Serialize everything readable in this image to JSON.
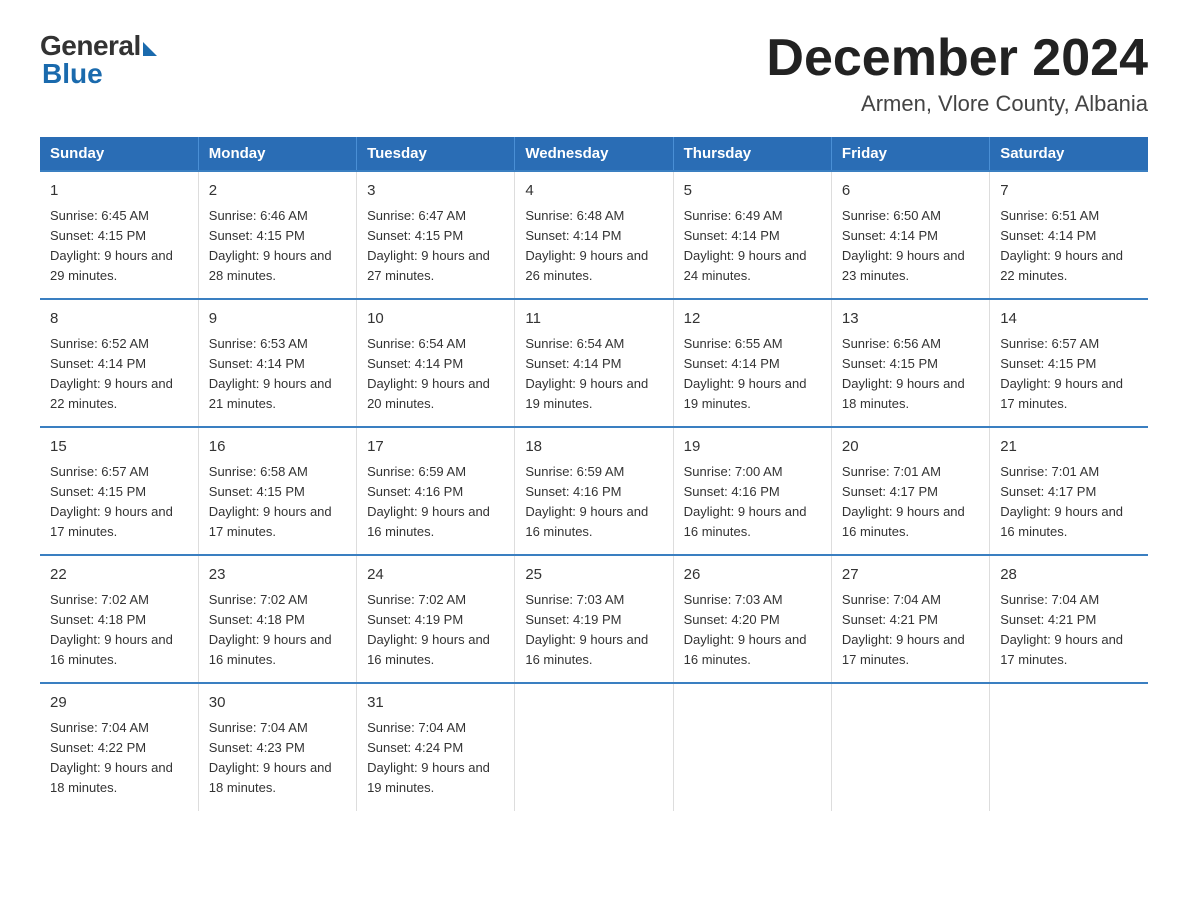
{
  "logo": {
    "general": "General",
    "blue": "Blue"
  },
  "title": "December 2024",
  "subtitle": "Armen, Vlore County, Albania",
  "days_of_week": [
    "Sunday",
    "Monday",
    "Tuesday",
    "Wednesday",
    "Thursday",
    "Friday",
    "Saturday"
  ],
  "weeks": [
    [
      {
        "day": "1",
        "sunrise": "6:45 AM",
        "sunset": "4:15 PM",
        "daylight": "9 hours and 29 minutes."
      },
      {
        "day": "2",
        "sunrise": "6:46 AM",
        "sunset": "4:15 PM",
        "daylight": "9 hours and 28 minutes."
      },
      {
        "day": "3",
        "sunrise": "6:47 AM",
        "sunset": "4:15 PM",
        "daylight": "9 hours and 27 minutes."
      },
      {
        "day": "4",
        "sunrise": "6:48 AM",
        "sunset": "4:14 PM",
        "daylight": "9 hours and 26 minutes."
      },
      {
        "day": "5",
        "sunrise": "6:49 AM",
        "sunset": "4:14 PM",
        "daylight": "9 hours and 24 minutes."
      },
      {
        "day": "6",
        "sunrise": "6:50 AM",
        "sunset": "4:14 PM",
        "daylight": "9 hours and 23 minutes."
      },
      {
        "day": "7",
        "sunrise": "6:51 AM",
        "sunset": "4:14 PM",
        "daylight": "9 hours and 22 minutes."
      }
    ],
    [
      {
        "day": "8",
        "sunrise": "6:52 AM",
        "sunset": "4:14 PM",
        "daylight": "9 hours and 22 minutes."
      },
      {
        "day": "9",
        "sunrise": "6:53 AM",
        "sunset": "4:14 PM",
        "daylight": "9 hours and 21 minutes."
      },
      {
        "day": "10",
        "sunrise": "6:54 AM",
        "sunset": "4:14 PM",
        "daylight": "9 hours and 20 minutes."
      },
      {
        "day": "11",
        "sunrise": "6:54 AM",
        "sunset": "4:14 PM",
        "daylight": "9 hours and 19 minutes."
      },
      {
        "day": "12",
        "sunrise": "6:55 AM",
        "sunset": "4:14 PM",
        "daylight": "9 hours and 19 minutes."
      },
      {
        "day": "13",
        "sunrise": "6:56 AM",
        "sunset": "4:15 PM",
        "daylight": "9 hours and 18 minutes."
      },
      {
        "day": "14",
        "sunrise": "6:57 AM",
        "sunset": "4:15 PM",
        "daylight": "9 hours and 17 minutes."
      }
    ],
    [
      {
        "day": "15",
        "sunrise": "6:57 AM",
        "sunset": "4:15 PM",
        "daylight": "9 hours and 17 minutes."
      },
      {
        "day": "16",
        "sunrise": "6:58 AM",
        "sunset": "4:15 PM",
        "daylight": "9 hours and 17 minutes."
      },
      {
        "day": "17",
        "sunrise": "6:59 AM",
        "sunset": "4:16 PM",
        "daylight": "9 hours and 16 minutes."
      },
      {
        "day": "18",
        "sunrise": "6:59 AM",
        "sunset": "4:16 PM",
        "daylight": "9 hours and 16 minutes."
      },
      {
        "day": "19",
        "sunrise": "7:00 AM",
        "sunset": "4:16 PM",
        "daylight": "9 hours and 16 minutes."
      },
      {
        "day": "20",
        "sunrise": "7:01 AM",
        "sunset": "4:17 PM",
        "daylight": "9 hours and 16 minutes."
      },
      {
        "day": "21",
        "sunrise": "7:01 AM",
        "sunset": "4:17 PM",
        "daylight": "9 hours and 16 minutes."
      }
    ],
    [
      {
        "day": "22",
        "sunrise": "7:02 AM",
        "sunset": "4:18 PM",
        "daylight": "9 hours and 16 minutes."
      },
      {
        "day": "23",
        "sunrise": "7:02 AM",
        "sunset": "4:18 PM",
        "daylight": "9 hours and 16 minutes."
      },
      {
        "day": "24",
        "sunrise": "7:02 AM",
        "sunset": "4:19 PM",
        "daylight": "9 hours and 16 minutes."
      },
      {
        "day": "25",
        "sunrise": "7:03 AM",
        "sunset": "4:19 PM",
        "daylight": "9 hours and 16 minutes."
      },
      {
        "day": "26",
        "sunrise": "7:03 AM",
        "sunset": "4:20 PM",
        "daylight": "9 hours and 16 minutes."
      },
      {
        "day": "27",
        "sunrise": "7:04 AM",
        "sunset": "4:21 PM",
        "daylight": "9 hours and 17 minutes."
      },
      {
        "day": "28",
        "sunrise": "7:04 AM",
        "sunset": "4:21 PM",
        "daylight": "9 hours and 17 minutes."
      }
    ],
    [
      {
        "day": "29",
        "sunrise": "7:04 AM",
        "sunset": "4:22 PM",
        "daylight": "9 hours and 18 minutes."
      },
      {
        "day": "30",
        "sunrise": "7:04 AM",
        "sunset": "4:23 PM",
        "daylight": "9 hours and 18 minutes."
      },
      {
        "day": "31",
        "sunrise": "7:04 AM",
        "sunset": "4:24 PM",
        "daylight": "9 hours and 19 minutes."
      },
      null,
      null,
      null,
      null
    ]
  ]
}
